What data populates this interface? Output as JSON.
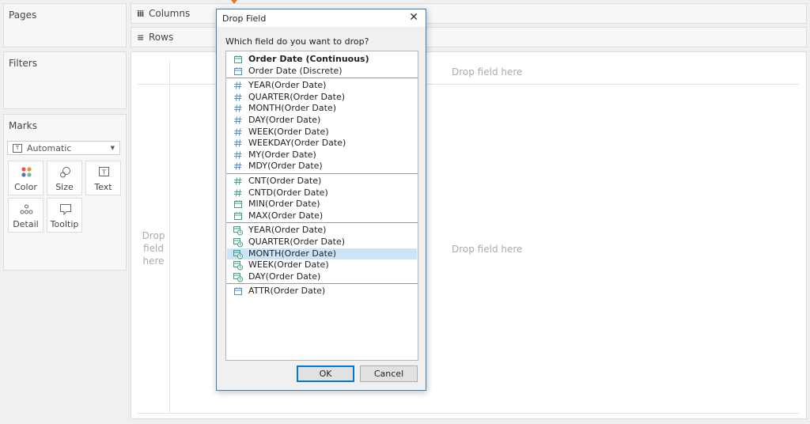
{
  "left_panels": {
    "pages_title": "Pages",
    "filters_title": "Filters",
    "marks_title": "Marks"
  },
  "marks": {
    "type_selected": "Automatic",
    "buttons": [
      "Color",
      "Size",
      "Text",
      "Detail",
      "Tooltip"
    ]
  },
  "shelves": {
    "columns_label": "Columns",
    "rows_label": "Rows"
  },
  "canvas": {
    "drop_top": "Drop field here",
    "drop_left": "Drop\nfield\nhere",
    "drop_center": "Drop field here"
  },
  "dialog": {
    "title": "Drop Field",
    "close_glyph": "✕",
    "question": "Which field do you want to drop?",
    "groups": [
      [
        {
          "label": "Order Date (Continuous)",
          "icon": "calendar-green-icon",
          "bold": true
        },
        {
          "label": "Order Date (Discrete)",
          "icon": "calendar-blue-icon"
        }
      ],
      [
        {
          "label": "YEAR(Order Date)",
          "icon": "hash-blue-icon"
        },
        {
          "label": "QUARTER(Order Date)",
          "icon": "hash-blue-icon"
        },
        {
          "label": "MONTH(Order Date)",
          "icon": "hash-blue-icon"
        },
        {
          "label": "DAY(Order Date)",
          "icon": "hash-blue-icon"
        },
        {
          "label": "WEEK(Order Date)",
          "icon": "hash-blue-icon"
        },
        {
          "label": "WEEKDAY(Order Date)",
          "icon": "hash-blue-icon"
        },
        {
          "label": "MY(Order Date)",
          "icon": "hash-blue-icon"
        },
        {
          "label": "MDY(Order Date)",
          "icon": "hash-blue-icon"
        }
      ],
      [
        {
          "label": "CNT(Order Date)",
          "icon": "hash-green-icon"
        },
        {
          "label": "CNTD(Order Date)",
          "icon": "hash-green-icon"
        },
        {
          "label": "MIN(Order Date)",
          "icon": "calendar-green-icon"
        },
        {
          "label": "MAX(Order Date)",
          "icon": "calendar-green-icon"
        }
      ],
      [
        {
          "label": "YEAR(Order Date)",
          "icon": "calendar-clock-green-icon"
        },
        {
          "label": "QUARTER(Order Date)",
          "icon": "calendar-clock-green-icon"
        },
        {
          "label": "MONTH(Order Date)",
          "icon": "calendar-clock-green-icon",
          "selected": true
        },
        {
          "label": "WEEK(Order Date)",
          "icon": "calendar-clock-green-icon"
        },
        {
          "label": "DAY(Order Date)",
          "icon": "calendar-clock-green-icon"
        }
      ],
      [
        {
          "label": "ATTR(Order Date)",
          "icon": "calendar-blue-icon"
        }
      ]
    ],
    "ok_label": "OK",
    "cancel_label": "Cancel"
  },
  "colors": {
    "blue": "#4e8fc7",
    "green": "#3aa17e",
    "selection": "#cce4f7",
    "accent": "#0078d7"
  }
}
